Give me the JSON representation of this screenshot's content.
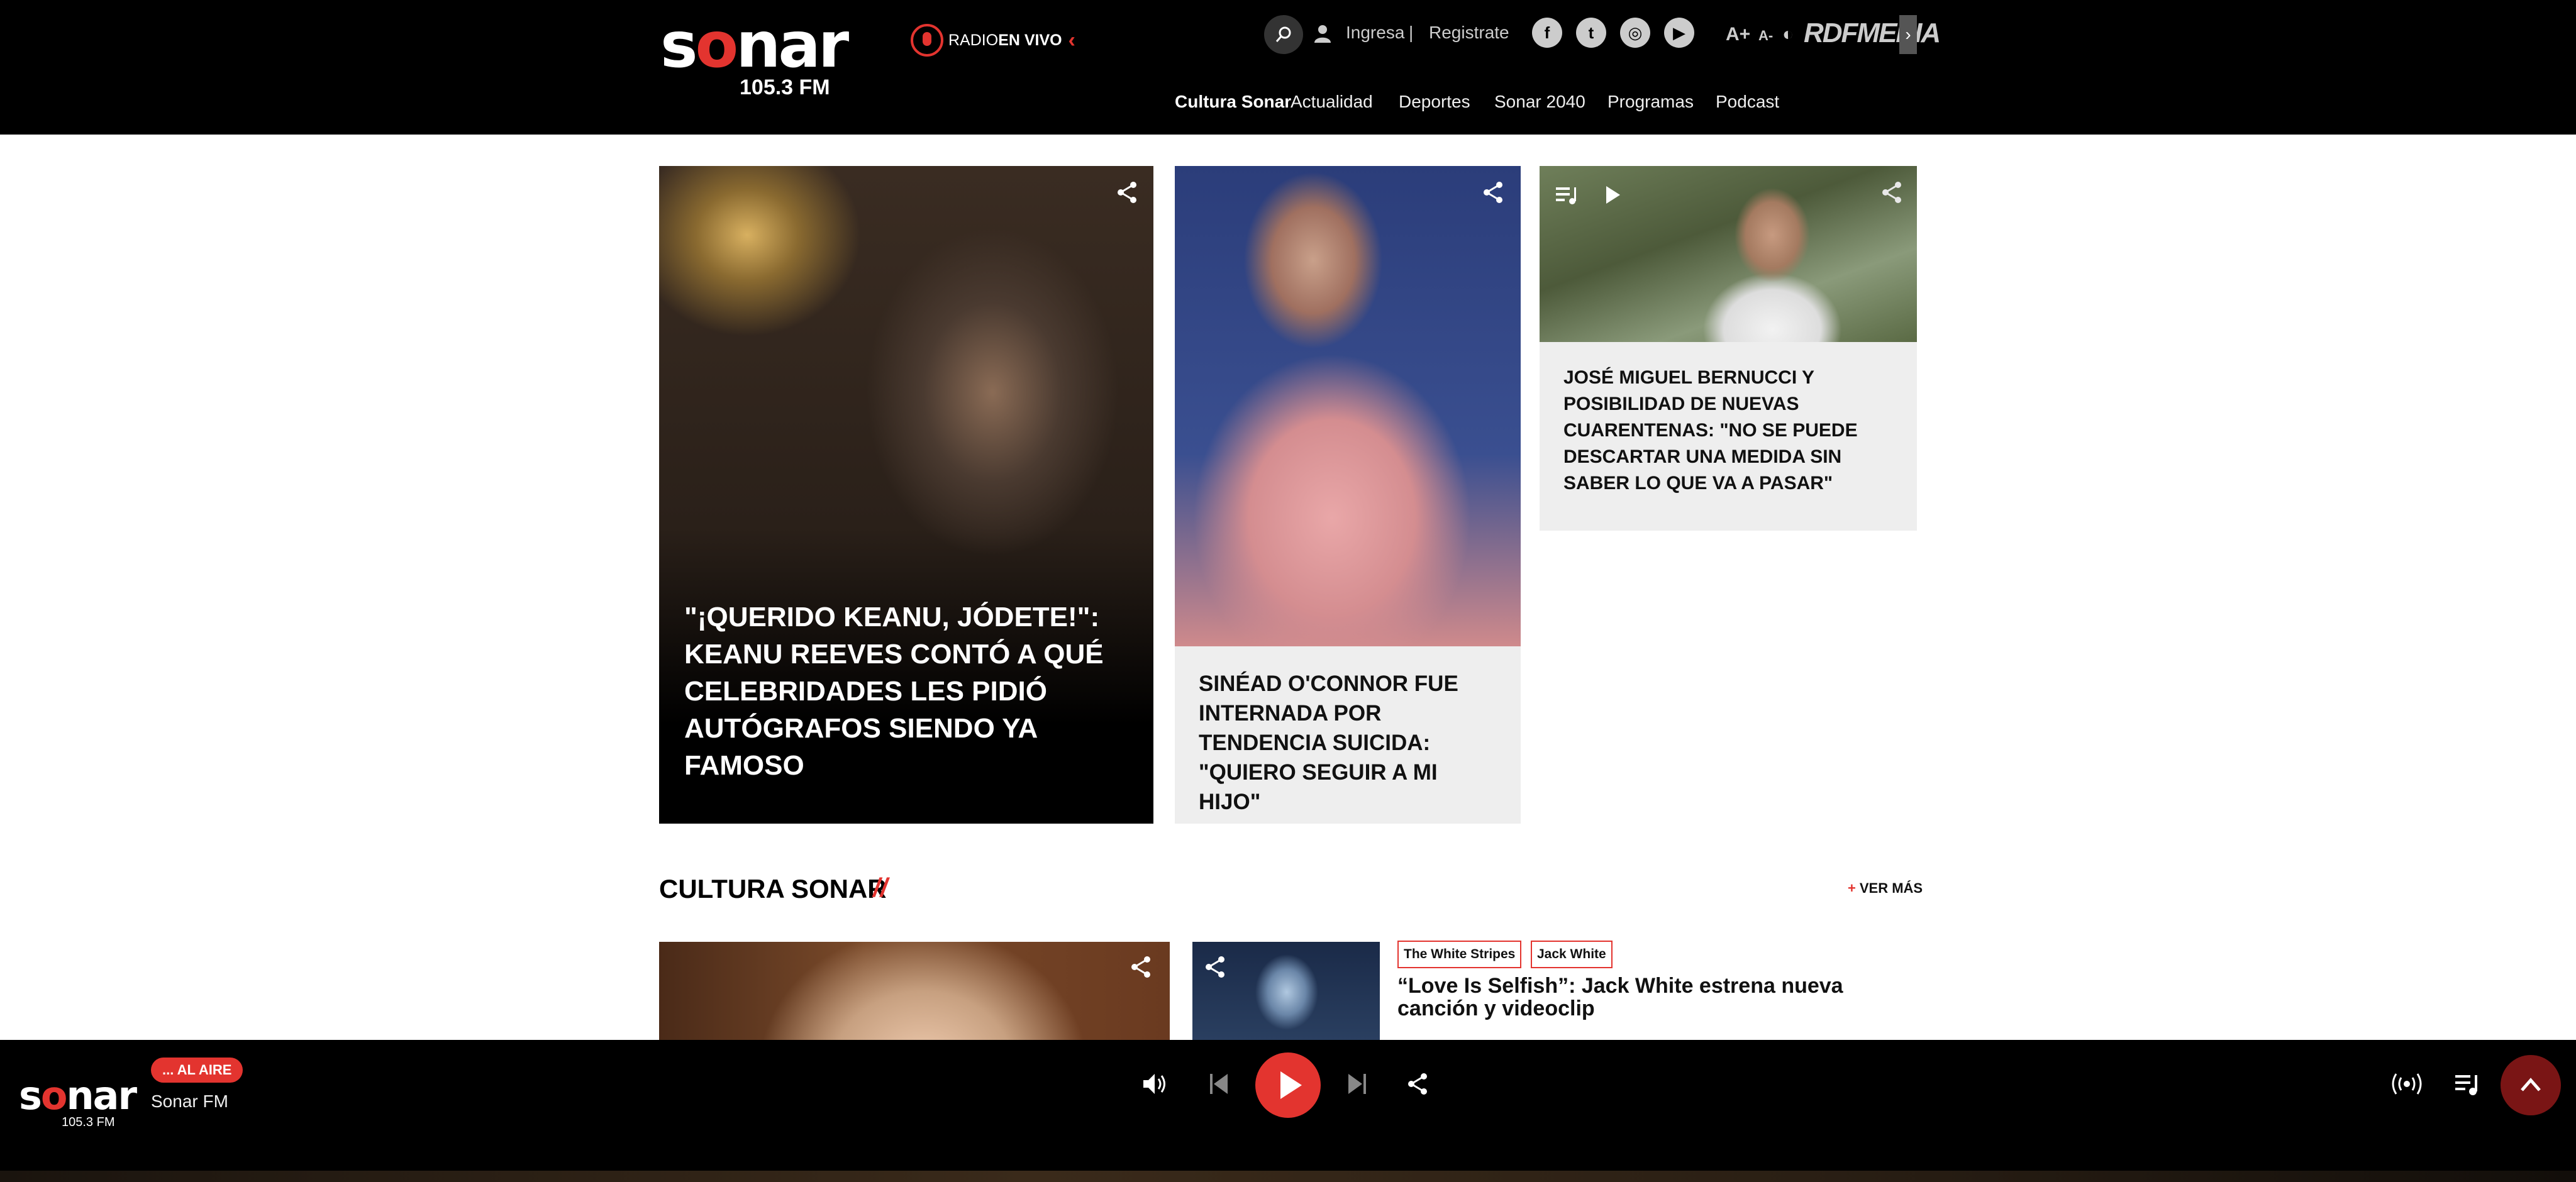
{
  "brand": {
    "logo_word": "sonar",
    "frequency": "105.3 FM"
  },
  "radio": {
    "prefix": "RADIO",
    "live": "EN VIVO"
  },
  "auth": {
    "login": "Ingresa",
    "separator": "|",
    "register": "Registrate"
  },
  "font_controls": {
    "increase": "A+",
    "decrease": "A-"
  },
  "network_logo": "RDFMEDIA",
  "nav": [
    {
      "label": "Cultura Sonar",
      "active": true
    },
    {
      "label": "Actualidad"
    },
    {
      "label": "Deportes"
    },
    {
      "label": "Sonar 2040"
    },
    {
      "label": "Programas"
    },
    {
      "label": "Podcast"
    }
  ],
  "featured": [
    {
      "title": "\"¡QUERIDO KEANU, JÓDETE!\": KEANU REEVES CONTÓ A QUÉ CELEBRIDADES LES PIDIÓ AUTÓGRAFOS SIENDO YA FAMOSO"
    },
    {
      "title": "SINÉAD O'CONNOR FUE INTERNADA POR TENDENCIA SUICIDA: \"QUIERO SEGUIR A MI HIJO\""
    },
    {
      "title": "JOSÉ MIGUEL BERNUCCI Y POSIBILIDAD DE NUEVAS CUARENTENAS: \"NO SE PUEDE DESCARTAR UNA MEDIDA SIN SABER LO QUE VA A PASAR\""
    }
  ],
  "section": {
    "title": "CULTURA SONAR",
    "slash": "//",
    "more": "VER MÁS",
    "plus": "+",
    "items": [
      {
        "tags": [
          "The White Stripes",
          "Jack White"
        ],
        "title": "“Love Is Selfish”: Jack White estrena nueva canción y videoclip"
      }
    ]
  },
  "player": {
    "logo_word": "sonar",
    "frequency": "105.3 FM",
    "badge": "... AL AIRE",
    "station": "Sonar FM"
  },
  "colors": {
    "accent": "#e3342f",
    "header_bg": "#000000",
    "card_bg": "#eeeeee"
  }
}
